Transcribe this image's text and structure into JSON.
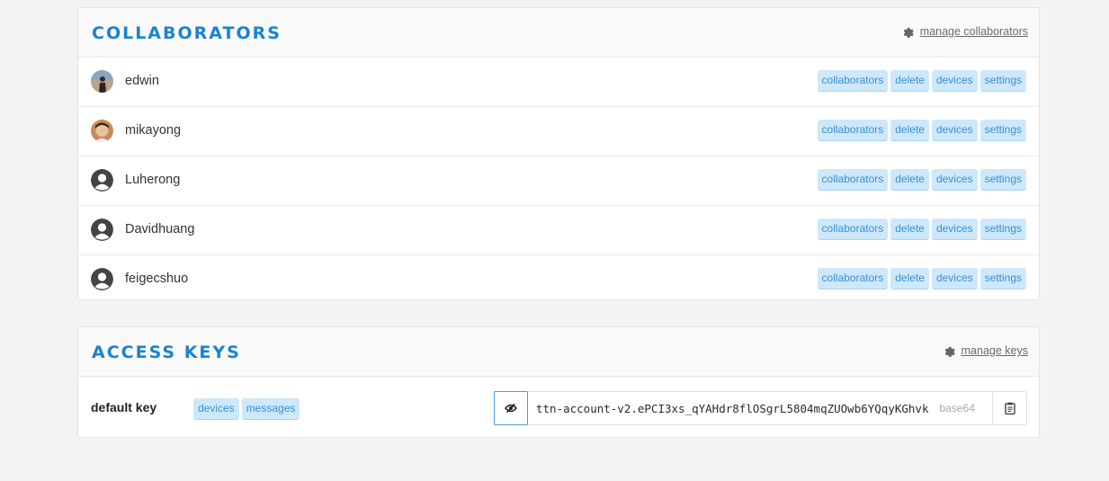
{
  "collaborators": {
    "title": "COLLABORATORS",
    "manage_label": "manage collaborators",
    "manage_icon": "gear-icon",
    "members": [
      {
        "name": "edwin",
        "avatar": "photo",
        "rights": [
          "collaborators",
          "delete",
          "devices",
          "settings"
        ]
      },
      {
        "name": "mikayong",
        "avatar": "photo",
        "rights": [
          "collaborators",
          "delete",
          "devices",
          "settings"
        ]
      },
      {
        "name": "Luherong",
        "avatar": "default",
        "rights": [
          "collaborators",
          "delete",
          "devices",
          "settings"
        ]
      },
      {
        "name": "Davidhuang",
        "avatar": "default",
        "rights": [
          "collaborators",
          "delete",
          "devices",
          "settings"
        ]
      },
      {
        "name": "feigecshuo",
        "avatar": "default",
        "rights": [
          "collaborators",
          "delete",
          "devices",
          "settings"
        ]
      }
    ]
  },
  "access_keys": {
    "title": "ACCESS KEYS",
    "manage_label": "manage keys",
    "manage_icon": "gear-icon",
    "keys": [
      {
        "name": "default key",
        "rights": [
          "devices",
          "messages"
        ],
        "value": "ttn-account-v2.ePCI3xs_qYAHdr8flOSgrL5804mqZUOwb6YQqyKGhvk",
        "encoding": "base64",
        "toggle_icon": "eye-slash-icon",
        "copy_icon": "clipboard-icon"
      }
    ]
  },
  "colors": {
    "accent": "#1b83cd",
    "tag_bg": "#cde8fb",
    "tag_text": "#3a8fd0",
    "background": "#f3f3f3"
  }
}
